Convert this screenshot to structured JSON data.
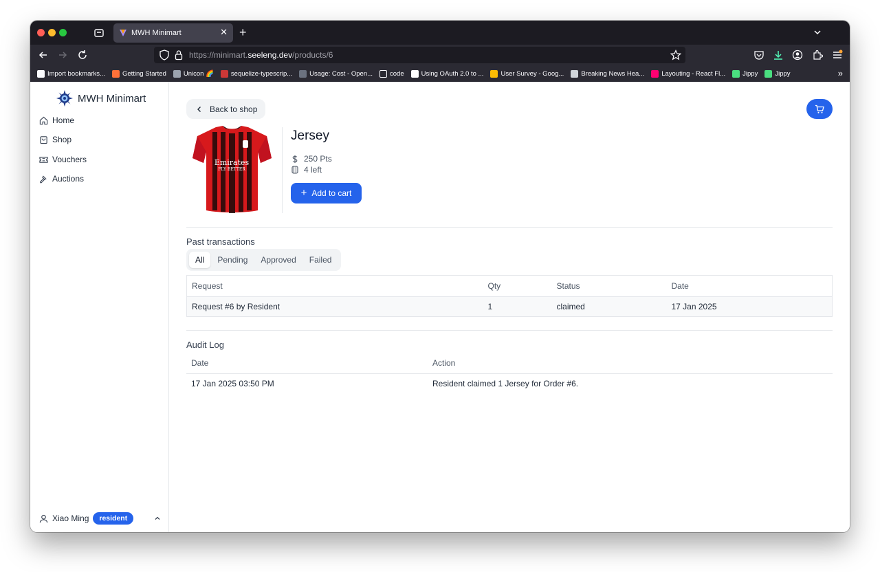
{
  "browser": {
    "tab_title": "MWH Minimart",
    "url_prefix": "https://minimart.",
    "url_domain": "seeleng.dev",
    "url_path": "/products/6",
    "bookmarks": [
      {
        "label": "Import bookmarks...",
        "icon": "import-icon",
        "color": "#fbfbfe"
      },
      {
        "label": "Getting Started",
        "icon": "firefox-icon",
        "color": "#ff7139"
      },
      {
        "label": "Unicon 🌈",
        "icon": "unicon-icon",
        "color": "#9ca3af"
      },
      {
        "label": "sequelize-typescrip...",
        "icon": "npm-icon",
        "color": "#cb3837"
      },
      {
        "label": "Usage: Cost - Open...",
        "icon": "openai-icon",
        "color": "#6b7280"
      },
      {
        "label": "code",
        "icon": "folder-icon",
        "color": "#2b2a33"
      },
      {
        "label": "Using OAuth 2.0 to ...",
        "icon": "google-icon",
        "color": "#ffffff"
      },
      {
        "label": "User Survey - Goog...",
        "icon": "drive-icon",
        "color": "#fbbc04"
      },
      {
        "label": "Breaking News Hea...",
        "icon": "news-icon",
        "color": "#d1d5db"
      },
      {
        "label": "Layouting - React Fl...",
        "icon": "reactflow-icon",
        "color": "#ff0072"
      },
      {
        "label": "Jippy",
        "icon": "jippy-icon",
        "color": "#4ade80"
      },
      {
        "label": "Jippy",
        "icon": "jippy-icon",
        "color": "#4ade80"
      }
    ]
  },
  "sidebar": {
    "brand": "MWH Minimart",
    "items": [
      {
        "label": "Home",
        "icon": "home-icon"
      },
      {
        "label": "Shop",
        "icon": "shopping-bag-icon"
      },
      {
        "label": "Vouchers",
        "icon": "ticket-icon"
      },
      {
        "label": "Auctions",
        "icon": "gavel-icon"
      }
    ],
    "user": {
      "name": "Xiao Ming",
      "role": "resident"
    }
  },
  "product": {
    "back_label": "Back to shop",
    "title": "Jersey",
    "price": "250 Pts",
    "stock": "4 left",
    "add_label": "Add to cart",
    "jersey_text_1": "Emirates",
    "jersey_text_2": "FLY BETTER"
  },
  "transactions": {
    "title": "Past transactions",
    "filters": [
      "All",
      "Pending",
      "Approved",
      "Failed"
    ],
    "active_filter": "All",
    "columns": [
      "Request",
      "Qty",
      "Status",
      "Date"
    ],
    "rows": [
      {
        "request": "Request #6 by Resident",
        "qty": "1",
        "status": "claimed",
        "date": "17 Jan 2025"
      }
    ]
  },
  "audit": {
    "title": "Audit Log",
    "columns": [
      "Date",
      "Action"
    ],
    "rows": [
      {
        "date": "17 Jan 2025 03:50 PM",
        "action": "Resident claimed 1 Jersey for Order #6."
      }
    ]
  },
  "colors": {
    "accent": "#2563eb"
  }
}
